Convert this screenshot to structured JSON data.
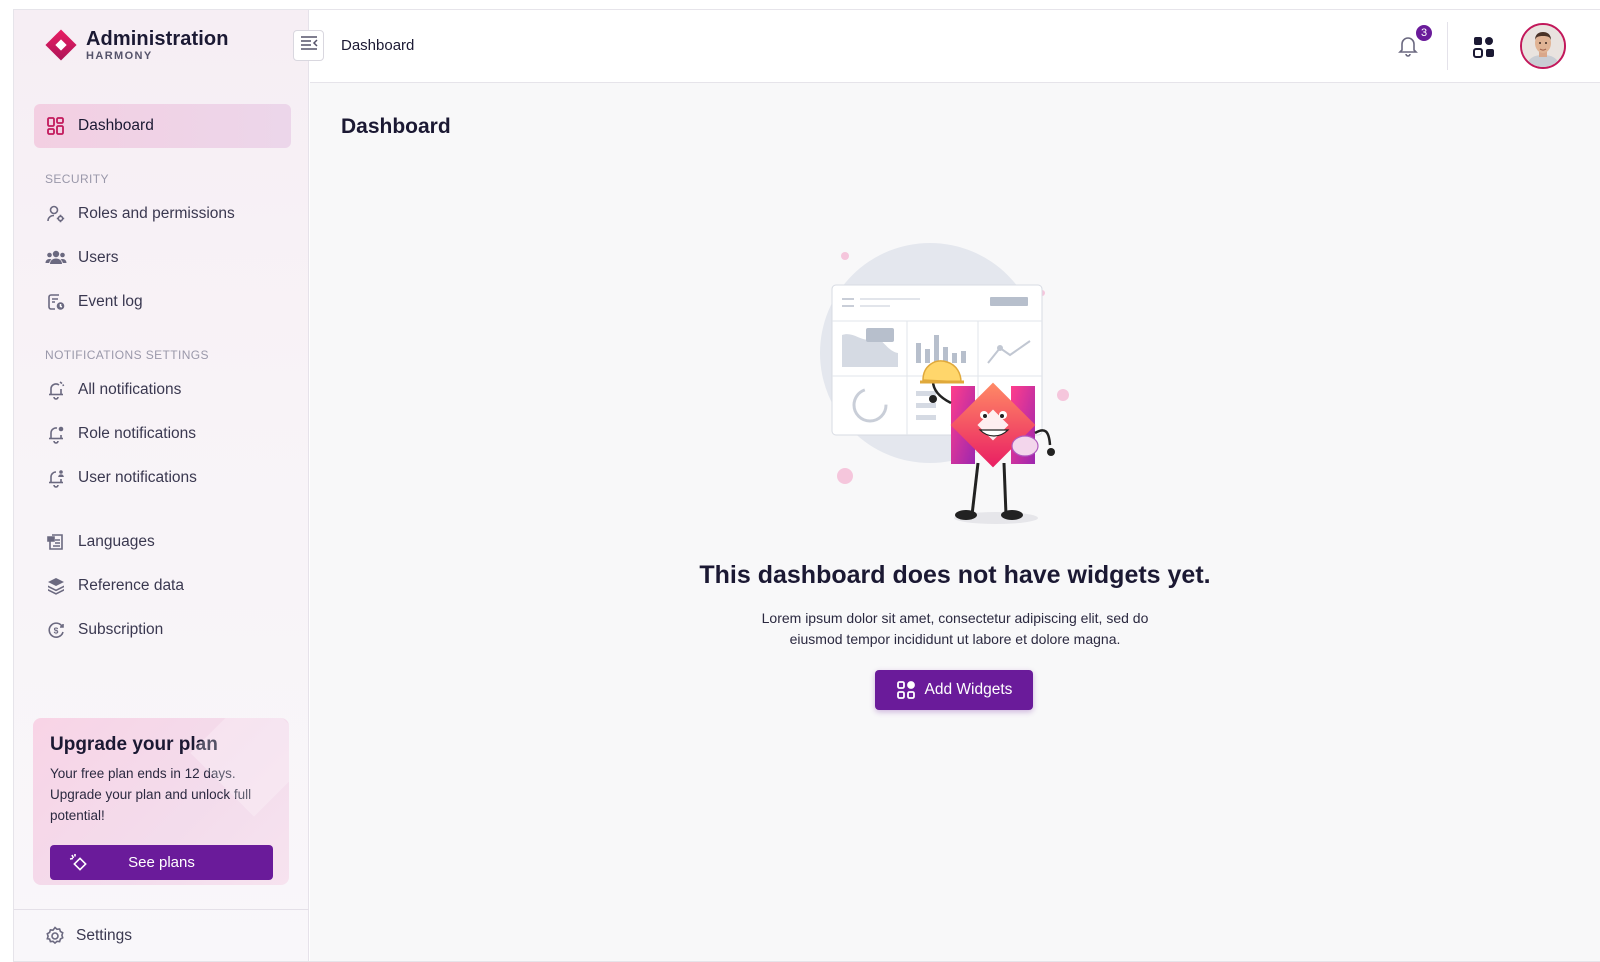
{
  "brand": {
    "title": "Administration",
    "subtitle": "HARMONY"
  },
  "header": {
    "breadcrumb": "Dashboard",
    "notification_count": "3"
  },
  "sidebar": {
    "dashboard": "Dashboard",
    "security_label": "SECURITY",
    "roles": "Roles and permissions",
    "users": "Users",
    "event_log": "Event log",
    "notifications_label": "NOTIFICATIONS SETTINGS",
    "all_notifications": "All notifications",
    "role_notifications": "Role notifications",
    "user_notifications": "User notifications",
    "languages": "Languages",
    "reference_data": "Reference data",
    "subscription": "Subscription",
    "settings": "Settings"
  },
  "upgrade": {
    "title": "Upgrade your plan",
    "text": "Your free plan ends in 12 days. Upgrade your plan and unlock full potential!",
    "button": "See plans"
  },
  "main": {
    "title": "Dashboard",
    "empty_title": "This dashboard does not have widgets yet.",
    "empty_text": "Lorem ipsum dolor sit amet, consectetur adipiscing elit, sed do eiusmod tempor incididunt ut labore et dolore magna.",
    "add_button": "Add Widgets"
  },
  "colors": {
    "accent": "#6a1b9a",
    "brand_pink": "#c2185b",
    "active_bg": "#f3cfe2"
  },
  "icons": [
    "dashboard-icon",
    "roles-icon",
    "users-icon",
    "event-log-icon",
    "bell-icon",
    "bell-gear-icon",
    "bell-lock-icon",
    "languages-icon",
    "reference-data-icon",
    "subscription-icon",
    "settings-icon",
    "apps-icon",
    "sidebar-collapse-icon",
    "widgets-icon",
    "tag-icon"
  ]
}
